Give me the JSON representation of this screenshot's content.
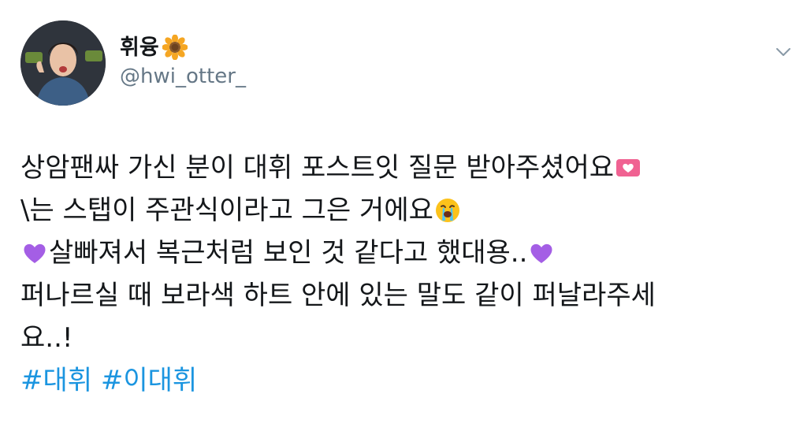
{
  "author": {
    "display_name": "휘융",
    "name_emoji": "sunflower-icon",
    "handle": "@hwi_otter_"
  },
  "menu": {
    "icon": "chevron-down-icon"
  },
  "tweet": {
    "lines": [
      {
        "text": "상암팬싸 가신 분이 대휘 포스트잇 질문 받아주셨어요",
        "trailing_emoji": "heart-letter-icon"
      },
      {
        "text": "\\는 스탭이 주관식이라고 그은 거에요",
        "trailing_emoji": "crying-face-icon"
      },
      {
        "leading_emoji": "purple-heart-icon",
        "text": "살빠져서 복근처럼 보인 것 같다고 했대용..",
        "trailing_emoji": "purple-heart-icon"
      },
      {
        "text": "퍼나르실 때 보라색 하트 안에 있는 말도 같이 퍼날라주세"
      },
      {
        "text": "요..!"
      }
    ],
    "hashtags": [
      "#대휘",
      "#이대휘"
    ]
  },
  "colors": {
    "text": "#14171a",
    "secondary": "#657786",
    "link": "#1b95e0"
  }
}
